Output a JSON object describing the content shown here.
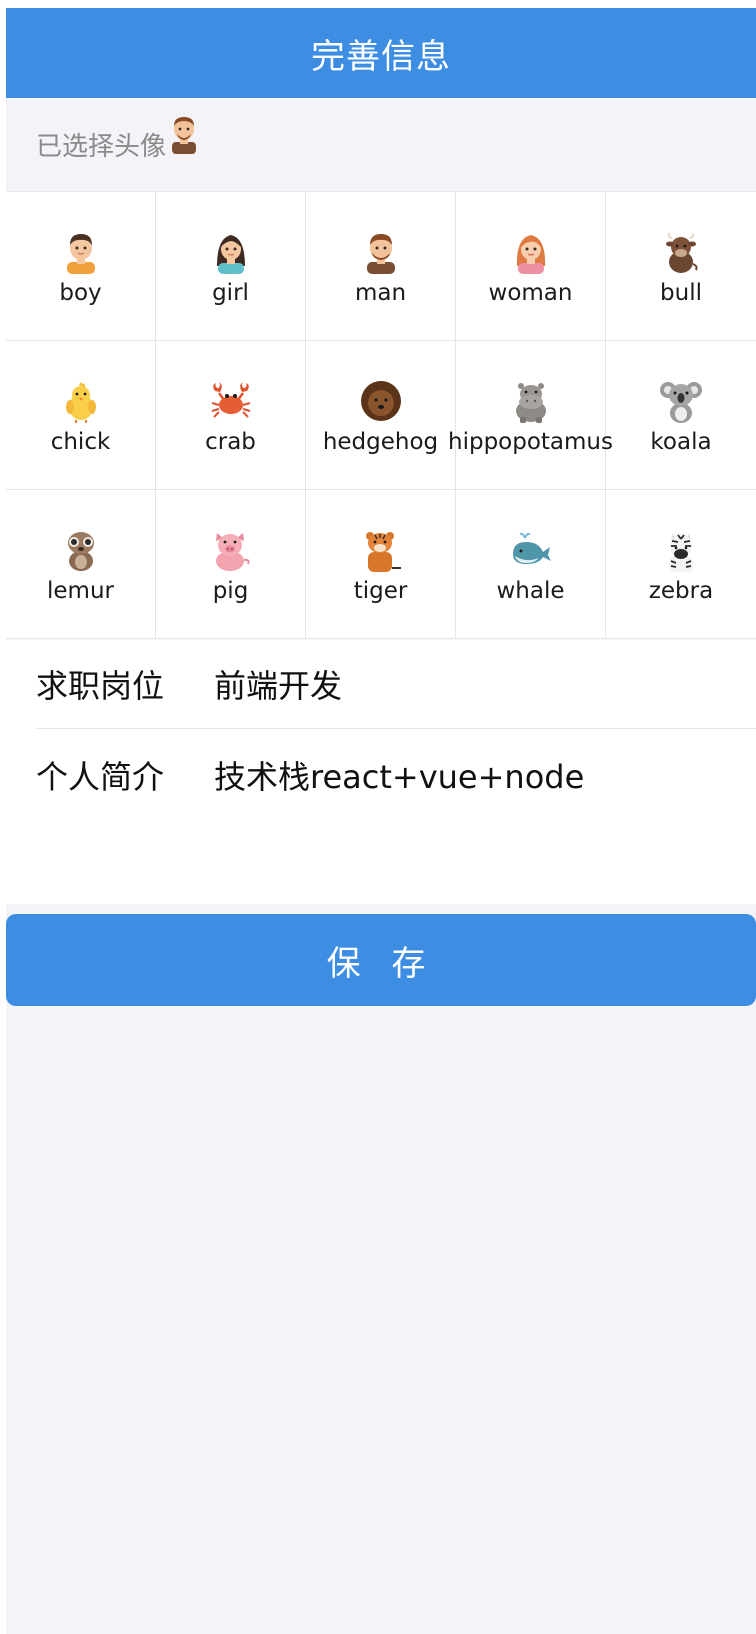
{
  "navbar": {
    "title": "完善信息"
  },
  "avatar_section": {
    "selected_label": "已选择头像",
    "selected_avatar": "man"
  },
  "avatars": [
    {
      "name": "boy"
    },
    {
      "name": "girl"
    },
    {
      "name": "man"
    },
    {
      "name": "woman"
    },
    {
      "name": "bull"
    },
    {
      "name": "chick"
    },
    {
      "name": "crab"
    },
    {
      "name": "hedgehog"
    },
    {
      "name": "hippopotamus"
    },
    {
      "name": "koala"
    },
    {
      "name": "lemur"
    },
    {
      "name": "pig"
    },
    {
      "name": "tiger"
    },
    {
      "name": "whale"
    },
    {
      "name": "zebra"
    }
  ],
  "form": {
    "position_label": "求职岗位",
    "position_value": "前端开发",
    "intro_label": "个人简介",
    "intro_value": "技术栈react+vue+node"
  },
  "save_button": {
    "label": "保 存"
  },
  "colors": {
    "primary": "#3d8ee2",
    "background": "#f3f3f8"
  }
}
